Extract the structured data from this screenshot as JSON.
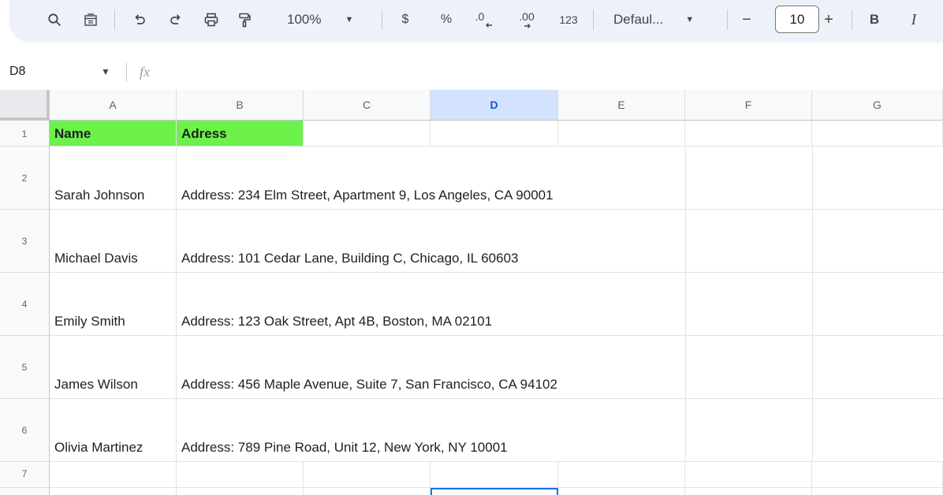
{
  "toolbar": {
    "zoom": "100%",
    "currency": "$",
    "percent": "%",
    "decrease_decimal": ".0",
    "increase_decimal": ".00",
    "number_format": "123",
    "font_name": "Defaul...",
    "font_size": "10",
    "bold": "B",
    "italic": "I",
    "minus": "−",
    "plus": "+"
  },
  "formula_bar": {
    "name_box": "D8",
    "fx": "fx"
  },
  "sheet": {
    "columns": [
      "A",
      "B",
      "C",
      "D",
      "E",
      "F",
      "G"
    ],
    "selected_column": "D",
    "rows": [
      "1",
      "2",
      "3",
      "4",
      "5",
      "6",
      "7"
    ],
    "header_row": {
      "a": "Name",
      "b": "Adress"
    },
    "data": [
      {
        "name": "Sarah Johnson",
        "address": "Address: 234 Elm Street, Apartment 9, Los Angeles, CA 90001"
      },
      {
        "name": "Michael Davis",
        "address": "Address: 101 Cedar Lane, Building C, Chicago, IL 60603"
      },
      {
        "name": "Emily Smith",
        "address": "Address: 123 Oak Street, Apt 4B, Boston, MA 02101"
      },
      {
        "name": "James Wilson",
        "address": "Address: 456 Maple Avenue, Suite 7, San Francisco, CA 94102"
      },
      {
        "name": "Olivia Martinez",
        "address": "Address: 789 Pine Road, Unit 12, New York, NY 10001"
      }
    ],
    "header_fill_color": "#6cf24a",
    "selection_color": "#1a73e8"
  }
}
